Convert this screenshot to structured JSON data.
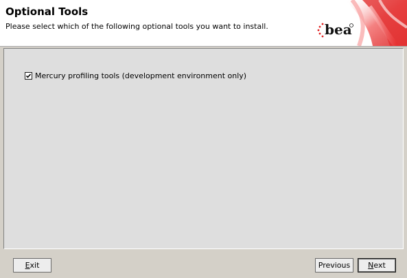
{
  "header": {
    "title": "Optional Tools",
    "subtitle": "Please select which of the following optional tools you want to install.",
    "logo_text": "bea"
  },
  "options": [
    {
      "label": "Mercury profiling tools (development environment only)",
      "checked": true
    }
  ],
  "buttons": {
    "exit_first": "E",
    "exit_rest": "xit",
    "previous_label": "Previous",
    "next_first": "N",
    "next_rest": "ext"
  },
  "colors": {
    "logo_red": "#e02020",
    "panel_bg": "#dedede",
    "window_bg": "#d4d0c8"
  }
}
